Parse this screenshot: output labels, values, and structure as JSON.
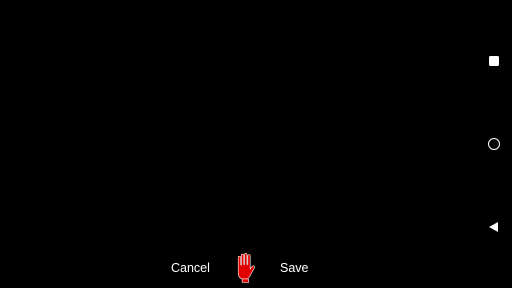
{
  "actions": {
    "cancel_label": "Cancel",
    "save_label": "Save",
    "hand_icon": "raised-hand-icon",
    "hand_color": "#e00000"
  },
  "navigation": {
    "recents_icon": "square-icon",
    "home_icon": "circle-icon",
    "back_icon": "triangle-back-icon"
  },
  "colors": {
    "background": "#000000",
    "foreground": "#ffffff"
  }
}
